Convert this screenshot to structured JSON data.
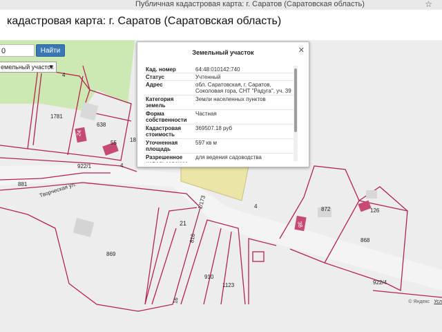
{
  "browser": {
    "tab_text": "Публичная кадастровая карта: г. Саратов (Саратовская область)",
    "bookmark_icon": "star-icon"
  },
  "header": {
    "title": "кадастровая карта: г. Саратов (Саратовская область)"
  },
  "search": {
    "value": "0",
    "button_label": "Найти"
  },
  "layer_select": {
    "value": "емельный участок"
  },
  "popup": {
    "title": "Земельный участок",
    "rows": [
      {
        "label": "Кад. номер",
        "value": "64:48:010142:740"
      },
      {
        "label": "Статус",
        "value": "Учтенный"
      },
      {
        "label": "Адрес",
        "value": "обл. Саратовская, г. Саратов, Соколовая гора, СНТ \"Радуга\", уч. 39"
      },
      {
        "label": "Категория земель",
        "value": "Земли населенных пунктов"
      },
      {
        "label": "Форма собственности",
        "value": "Частная"
      },
      {
        "label": "Кадастровая стоимость",
        "value": "369507.18 руб"
      },
      {
        "label": "Уточненная площадь",
        "value": "597 кв м"
      },
      {
        "label": "Разрешенное использование",
        "value": "для ведения садоводства"
      }
    ]
  },
  "map": {
    "parcels": [
      "4",
      "1781",
      "638",
      "55",
      "18",
      "881",
      "922/1",
      "4",
      "1/173",
      "21",
      "816",
      "869",
      "910",
      "1123",
      "16",
      "872",
      "126",
      "868",
      "922/4",
      "4",
      "24",
      "38"
    ],
    "streets": [
      "Творческая ул."
    ],
    "attribution": "© Яндекс",
    "terms_link": "Усл"
  },
  "colors": {
    "parcel_border": "#b4234f",
    "selected_parcel": "#ece5a8",
    "green_zone": "#cde8b2",
    "button": "#3a78b5"
  }
}
